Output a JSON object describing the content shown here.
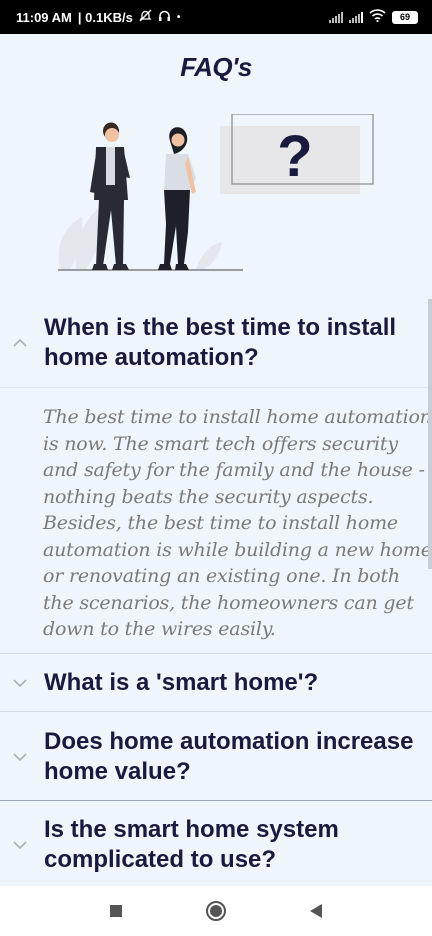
{
  "status_bar": {
    "time": "11:09 AM",
    "net_speed": "| 0.1KB/s",
    "battery": "69"
  },
  "page": {
    "title": "FAQ's"
  },
  "illustration": {
    "question_mark": "?"
  },
  "faqs": [
    {
      "question": "When is the best time to install home automation?",
      "answer": "The best time to install home automation is now. The smart tech offers security and safety for the family and the house - nothing beats the security aspects. Besides, the best time to install home automation is while building a new home or renovating an existing one. In both the scenarios, the homeowners can get down to the wires easily.",
      "expanded": true
    },
    {
      "question": "What is a 'smart home'?",
      "expanded": false
    },
    {
      "question": "Does home automation increase home value?",
      "expanded": false
    },
    {
      "question": "Is the smart home system complicated to use?",
      "expanded": false
    }
  ],
  "icons": {
    "expanded": "chevron-up-icon",
    "collapsed": "chevron-down-icon",
    "nav_recent": "square-icon",
    "nav_home": "circle-icon",
    "nav_back": "triangle-back-icon"
  },
  "colors": {
    "background": "#eef6fc",
    "title": "#1a1a3e",
    "answer_text": "#7a7a7a"
  }
}
